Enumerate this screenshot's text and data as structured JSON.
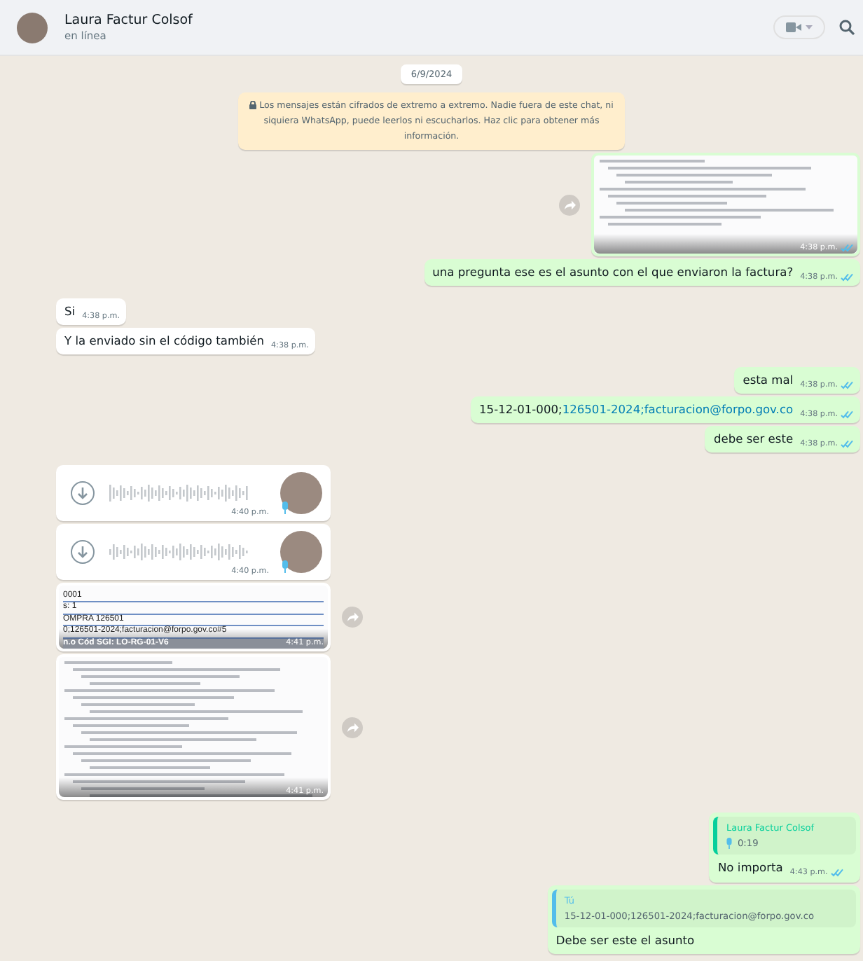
{
  "header": {
    "contact_name": "Laura Factur Colsof",
    "status": "en línea"
  },
  "date_chip": "6/9/2024",
  "encryption_notice": "Los mensajes están cifrados de extremo a extremo. Nadie fuera de este chat, ni siquiera WhatsApp, puede leerlos ni escucharlos. Haz clic para obtener más información.",
  "messages": [
    {
      "kind": "image",
      "outgoing": true,
      "time": "4:38 p.m.",
      "read": true,
      "tall": false
    },
    {
      "kind": "text",
      "outgoing": true,
      "segments": [
        {
          "text": "una pregunta ese es el asunto con el que enviaron la factura?"
        }
      ],
      "time": "4:38 p.m.",
      "read": true
    },
    {
      "kind": "text",
      "outgoing": false,
      "segments": [
        {
          "text": "Si"
        }
      ],
      "time": "4:38 p.m."
    },
    {
      "kind": "text",
      "outgoing": false,
      "segments": [
        {
          "text": "Y la enviado sin el código también"
        }
      ],
      "time": "4:38 p.m."
    },
    {
      "kind": "text",
      "outgoing": true,
      "segments": [
        {
          "text": "esta mal"
        }
      ],
      "time": "4:38 p.m.",
      "read": true
    },
    {
      "kind": "text",
      "outgoing": true,
      "segments": [
        {
          "text": "15-12-01-000;"
        },
        {
          "text": "126501-2024;facturacion@forpo.gov.co",
          "link": true
        }
      ],
      "time": "4:38 p.m.",
      "read": true
    },
    {
      "kind": "text",
      "outgoing": true,
      "segments": [
        {
          "text": "debe ser este"
        }
      ],
      "time": "4:38 p.m.",
      "read": true
    },
    {
      "kind": "audio",
      "outgoing": false,
      "time": "4:40 p.m."
    },
    {
      "kind": "audio",
      "outgoing": false,
      "time": "4:40 p.m."
    },
    {
      "kind": "document_image",
      "outgoing": false,
      "time": "4:41 p.m.",
      "lines": [
        "0001",
        "s: 1",
        "OMPRA 126501",
        "0;126501-2024;facturacion@forpo.gov.co#5",
        "n.o Cód SGI: LO-RG-01-V6"
      ]
    },
    {
      "kind": "image",
      "outgoing": false,
      "time": "4:41 p.m.",
      "tall": true
    },
    {
      "kind": "quoted",
      "outgoing": true,
      "quote_author": "Laura Factur Colsof",
      "quote_from_self": false,
      "quote_text": "0:19",
      "quote_is_voice": true,
      "segments": [
        {
          "text": "No importa"
        }
      ],
      "time": "4:43 p.m.",
      "read": true
    },
    {
      "kind": "quoted",
      "outgoing": true,
      "quote_author": "Tú",
      "quote_from_self": true,
      "quote_text": "15-12-01-000;126501-2024;facturacion@forpo.gov.co",
      "quote_is_voice": false,
      "segments": [
        {
          "text": "Debe ser este el asunto"
        }
      ]
    }
  ]
}
